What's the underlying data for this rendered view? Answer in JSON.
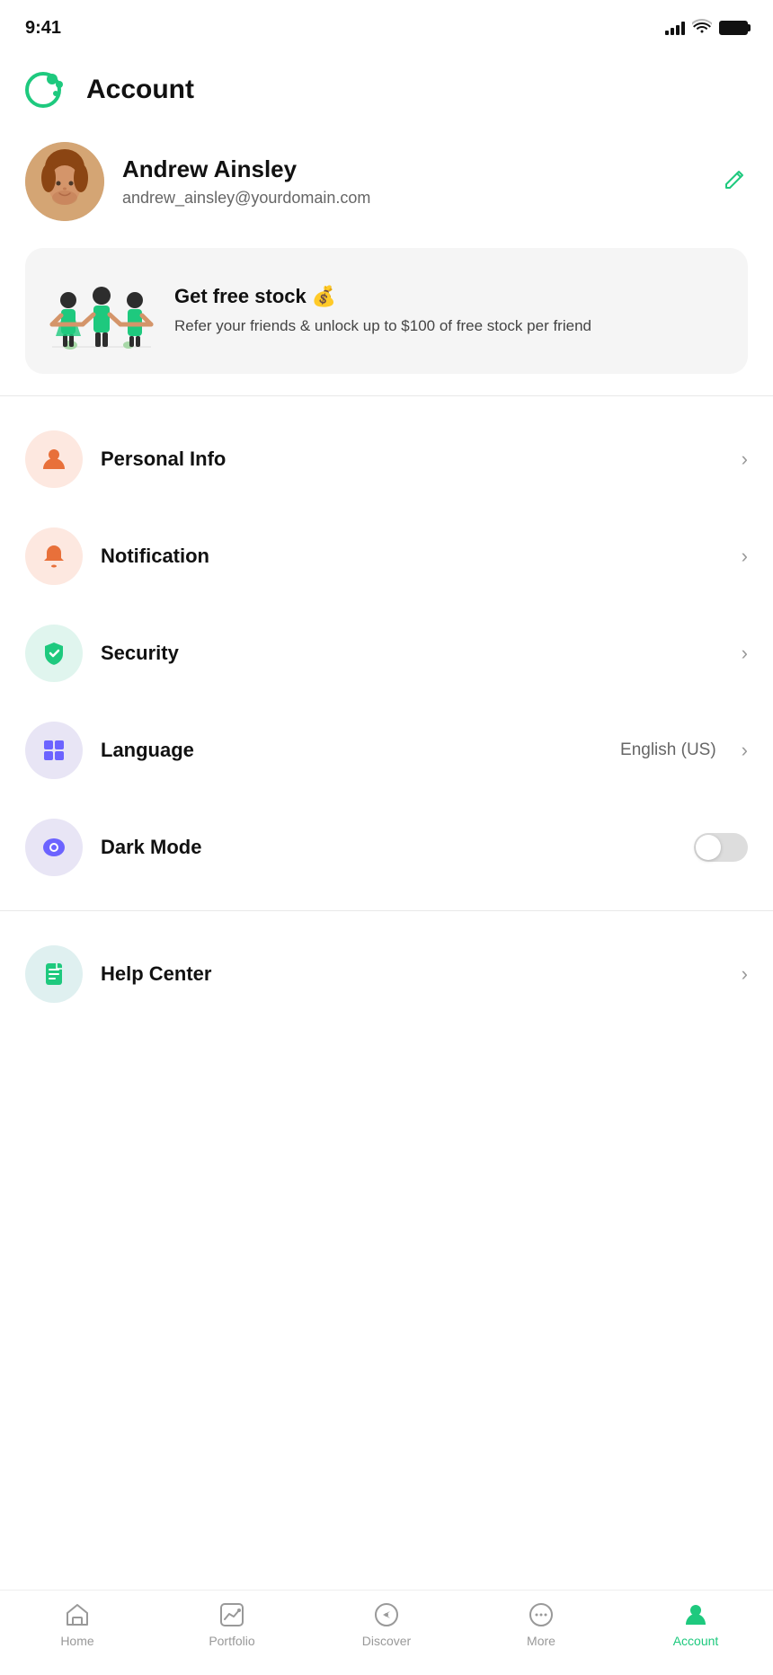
{
  "statusBar": {
    "time": "9:41"
  },
  "header": {
    "title": "Account",
    "logoAlt": "app-logo"
  },
  "profile": {
    "name": "Andrew Ainsley",
    "email": "andrew_ainsley@yourdomain.com",
    "editLabel": "edit"
  },
  "referral": {
    "title": "Get free stock 💰",
    "description": "Refer your friends & unlock up to $100 of free stock per friend"
  },
  "menuItems": [
    {
      "id": "personal-info",
      "label": "Personal Info",
      "iconColor": "peach",
      "iconType": "person",
      "hasChevron": true,
      "value": ""
    },
    {
      "id": "notification",
      "label": "Notification",
      "iconColor": "peach",
      "iconType": "bell",
      "hasChevron": true,
      "value": ""
    },
    {
      "id": "security",
      "label": "Security",
      "iconColor": "green",
      "iconType": "shield",
      "hasChevron": true,
      "value": ""
    },
    {
      "id": "language",
      "label": "Language",
      "iconColor": "purple",
      "iconType": "grid",
      "hasChevron": true,
      "value": "English (US)"
    },
    {
      "id": "dark-mode",
      "label": "Dark Mode",
      "iconColor": "purple",
      "iconType": "eye",
      "hasChevron": false,
      "hasToggle": true,
      "toggleOn": false,
      "value": ""
    }
  ],
  "section2": [
    {
      "id": "help-center",
      "label": "Help Center",
      "iconColor": "teal",
      "iconType": "doc",
      "hasChevron": true,
      "value": ""
    }
  ],
  "bottomNav": {
    "items": [
      {
        "id": "home",
        "label": "Home",
        "icon": "home",
        "active": false
      },
      {
        "id": "portfolio",
        "label": "Portfolio",
        "icon": "chart",
        "active": false
      },
      {
        "id": "discover",
        "label": "Discover",
        "icon": "compass",
        "active": false
      },
      {
        "id": "more",
        "label": "More",
        "icon": "more",
        "active": false
      },
      {
        "id": "account",
        "label": "Account",
        "icon": "person",
        "active": true
      }
    ]
  }
}
